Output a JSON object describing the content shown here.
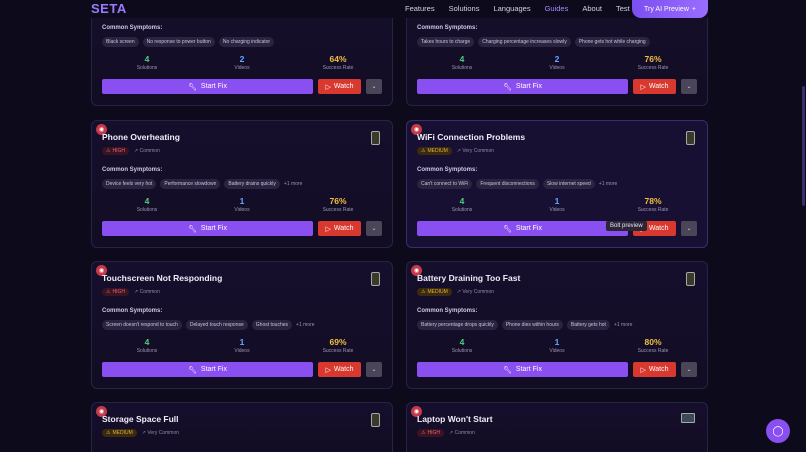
{
  "nav": {
    "brand": "SETA",
    "links": [
      "Features",
      "Solutions",
      "Languages",
      "Guides",
      "About",
      "Test"
    ],
    "active": "Guides",
    "cta": "Try AI Preview",
    "cta_icon": "plus-icon"
  },
  "symptoms_label": "Common Symptoms:",
  "stat_labels": {
    "solutions": "Solutions",
    "videos": "Videos",
    "success": "Success Rate"
  },
  "buttons": {
    "fix": "Start Fix",
    "watch": "Watch"
  },
  "tooltip": "Bolt preview",
  "colors": {
    "accent": "#8a4ff0",
    "watch": "#d8382e",
    "solutions": "#4bd07a",
    "videos": "#66a7ff",
    "success": "#f0c040"
  },
  "cards": [
    {
      "title": "",
      "severity": "",
      "frequency": "",
      "symptoms": [
        "Black screen",
        "No response to power button",
        "No charging indicator"
      ],
      "more": "",
      "solutions": "4",
      "videos": "2",
      "success": "64%"
    },
    {
      "title": "",
      "severity": "",
      "frequency": "",
      "symptoms": [
        "Takes hours to charge",
        "Charging percentage increases slowly",
        "Phone gets hot while charging"
      ],
      "more": "",
      "solutions": "4",
      "videos": "2",
      "success": "76%"
    },
    {
      "title": "Phone Overheating",
      "severity": "HIGH",
      "frequency": "Common",
      "symptoms": [
        "Device feels very hot",
        "Performance slowdown",
        "Battery drains quickly"
      ],
      "more": "+1 more",
      "solutions": "4",
      "videos": "1",
      "success": "76%"
    },
    {
      "title": "WiFi Connection Problems",
      "severity": "MEDIUM",
      "frequency": "Very Common",
      "symptoms": [
        "Can't connect to WiFi",
        "Frequent disconnections",
        "Slow internet speed"
      ],
      "more": "+1 more",
      "solutions": "4",
      "videos": "1",
      "success": "78%"
    },
    {
      "title": "Touchscreen Not Responding",
      "severity": "HIGH",
      "frequency": "Common",
      "symptoms": [
        "Screen doesn't respond to touch",
        "Delayed touch response",
        "Ghost touches"
      ],
      "more": "+1 more",
      "solutions": "4",
      "videos": "1",
      "success": "69%"
    },
    {
      "title": "Battery Draining Too Fast",
      "severity": "MEDIUM",
      "frequency": "Very Common",
      "symptoms": [
        "Battery percentage drops quickly",
        "Phone dies within hours",
        "Battery gets hot"
      ],
      "more": "+1 more",
      "solutions": "4",
      "videos": "1",
      "success": "80%"
    },
    {
      "title": "Storage Space Full",
      "severity": "MEDIUM",
      "frequency": "Very Common",
      "symptoms": [],
      "more": "",
      "solutions": "",
      "videos": "",
      "success": ""
    },
    {
      "title": "Laptop Won't Start",
      "severity": "HIGH",
      "frequency": "Common",
      "symptoms": [],
      "more": "",
      "solutions": "",
      "videos": "",
      "success": ""
    }
  ]
}
